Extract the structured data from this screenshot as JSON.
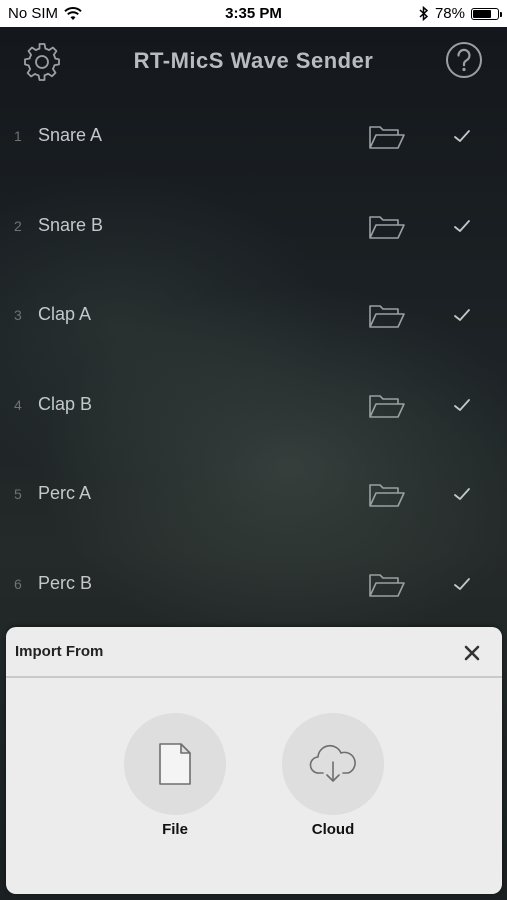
{
  "status_bar": {
    "carrier": "No SIM",
    "time": "3:35 PM",
    "battery_percent": "78%",
    "battery_level": 0.78
  },
  "header": {
    "title": "RT-MicS Wave Sender",
    "settings_icon": "gear-icon",
    "help_icon": "question-circle-icon"
  },
  "slots": [
    {
      "number": "1",
      "name": "Snare A"
    },
    {
      "number": "2",
      "name": "Snare B"
    },
    {
      "number": "3",
      "name": "Clap A"
    },
    {
      "number": "4",
      "name": "Clap B"
    },
    {
      "number": "5",
      "name": "Perc A"
    },
    {
      "number": "6",
      "name": "Perc B"
    }
  ],
  "import_sheet": {
    "title": "Import From",
    "options": [
      {
        "label": "File",
        "icon": "file-icon"
      },
      {
        "label": "Cloud",
        "icon": "cloud-download-icon"
      }
    ]
  },
  "colors": {
    "background_dark": "#1d2326",
    "title_text": "#b8bcbf",
    "sheet_background": "#ececec"
  }
}
